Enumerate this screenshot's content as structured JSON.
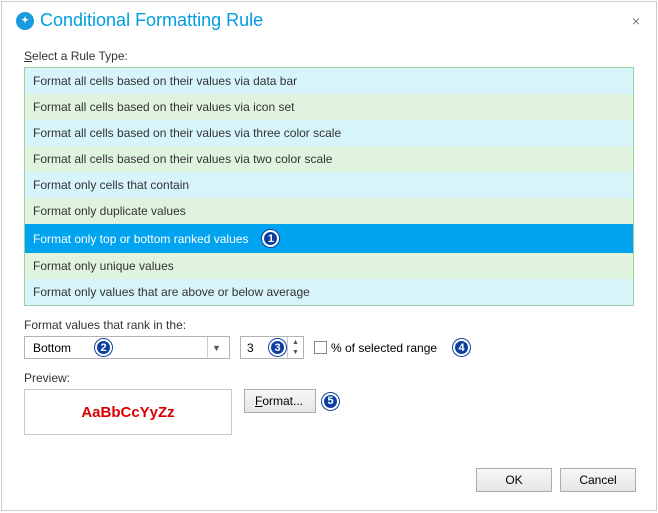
{
  "dialog": {
    "title": "Conditional Formatting Rule",
    "close_label": "×"
  },
  "labels": {
    "select_prefix": "S",
    "select_rest": "elect a Rule Type:",
    "rank_label": "Format values that rank in the:",
    "percent": "% of selected range",
    "preview": "Preview:"
  },
  "rule_types": {
    "items": [
      "Format all cells based on their values via data bar",
      "Format all cells based on their values via icon set",
      "Format all cells based on their values via three color scale",
      "Format all cells based on their values via two color scale",
      "Format only cells that contain",
      "Format only duplicate values",
      "Format only top or bottom ranked values",
      "Format only unique values",
      "Format only values that are above or below average"
    ],
    "selected_index": 6
  },
  "rank": {
    "direction": "Bottom",
    "count": "3"
  },
  "preview_text": "AaBbCcYyZz",
  "buttons": {
    "format": "Format...",
    "ok": "OK",
    "cancel": "Cancel"
  },
  "callouts": {
    "rule_selected": "1",
    "direction": "2",
    "count": "3",
    "percent": "4",
    "format": "5"
  }
}
